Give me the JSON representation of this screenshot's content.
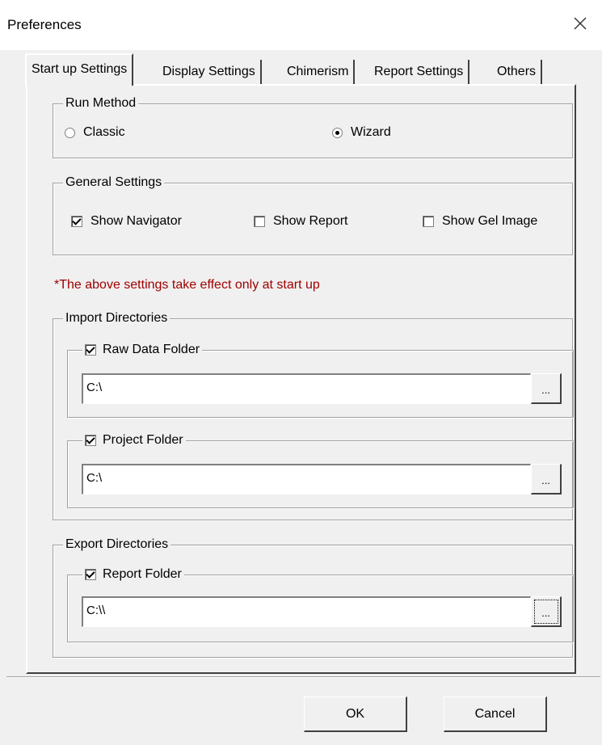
{
  "window": {
    "title": "Preferences",
    "close_icon": "close-icon"
  },
  "tabs": [
    {
      "label": "Start up Settings",
      "active": true
    },
    {
      "label": "Display Settings",
      "active": false
    },
    {
      "label": "Chimerism",
      "active": false
    },
    {
      "label": "Report Settings",
      "active": false
    },
    {
      "label": "Others",
      "active": false
    }
  ],
  "run_method": {
    "legend": "Run Method",
    "options": [
      {
        "label": "Classic",
        "selected": false
      },
      {
        "label": "Wizard",
        "selected": true
      }
    ]
  },
  "general_settings": {
    "legend": "General Settings",
    "options": [
      {
        "label": "Show Navigator",
        "checked": true
      },
      {
        "label": "Show Report",
        "checked": false
      },
      {
        "label": "Show Gel Image",
        "checked": false
      }
    ]
  },
  "note": "*The above settings take effect only at start up",
  "note_color": "#a00000",
  "import_directories": {
    "legend": "Import Directories",
    "raw_data_folder": {
      "label": "Raw Data Folder",
      "checked": true,
      "path": "C:\\",
      "browse_label": "..."
    },
    "project_folder": {
      "label": "Project Folder",
      "checked": true,
      "path": "C:\\",
      "browse_label": "..."
    }
  },
  "export_directories": {
    "legend": "Export Directories",
    "report_folder": {
      "label": "Report Folder",
      "checked": true,
      "path": "C:\\\\",
      "browse_label": "..."
    }
  },
  "buttons": {
    "ok": "OK",
    "cancel": "Cancel"
  }
}
